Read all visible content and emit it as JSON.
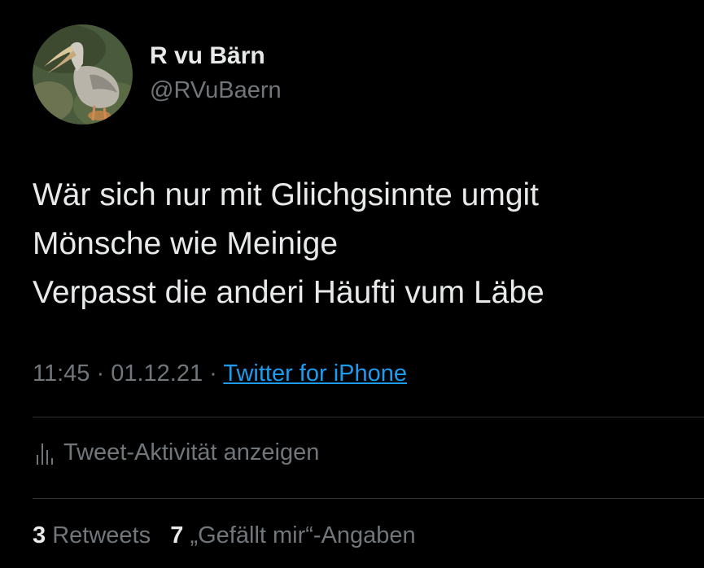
{
  "author": {
    "name": "R vu Bärn",
    "handle": "@RVuBaern",
    "avatar": "pelican-photo"
  },
  "tweet": {
    "lines": [
      "Wär sich nur mit Gliichgsinnte umgit",
      "Mönsche wie Meinige",
      "Verpasst die anderi Häufti vum Läbe"
    ]
  },
  "meta": {
    "time": "11:45",
    "separator": " · ",
    "date": "01.12.21",
    "source": "Twitter for iPhone"
  },
  "activity": {
    "label": "Tweet-Aktivität anzeigen",
    "icon": "bar-chart-icon"
  },
  "stats": {
    "retweets_count": "3",
    "retweets_label": "Retweets",
    "likes_count": "7",
    "likes_label": "„Gefällt mir“-Angaben"
  },
  "colors": {
    "background": "#000000",
    "primary_text": "#e7e9ea",
    "secondary_text": "#71767b",
    "link": "#1d9bf0",
    "divider": "#2f3336"
  }
}
